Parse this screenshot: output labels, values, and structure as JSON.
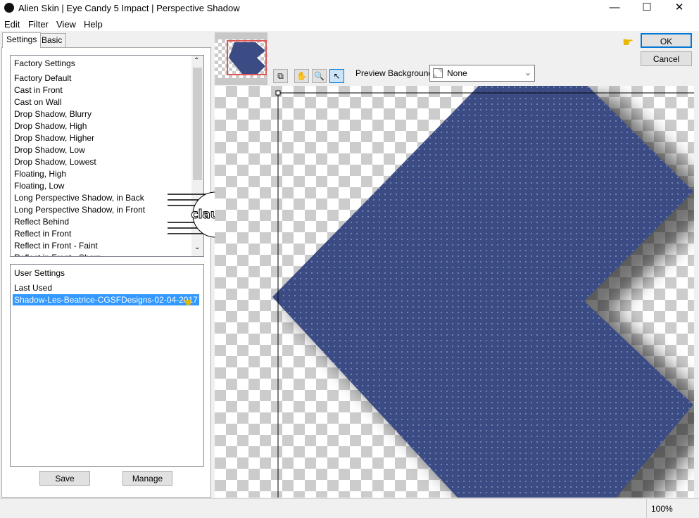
{
  "window": {
    "title": "Alien Skin | Eye Candy 5 Impact | Perspective Shadow",
    "minimize": "—",
    "maximize": "☐",
    "close": "✕"
  },
  "menu": [
    "Edit",
    "Filter",
    "View",
    "Help"
  ],
  "tabs": [
    "Settings",
    "Basic"
  ],
  "factory": {
    "header": "Factory Settings",
    "items": [
      "Factory Default",
      "Cast in Front",
      "Cast on Wall",
      "Drop Shadow, Blurry",
      "Drop Shadow, High",
      "Drop Shadow, Higher",
      "Drop Shadow, Low",
      "Drop Shadow, Lowest",
      "Floating, High",
      "Floating, Low",
      "Long Perspective Shadow, in Back",
      "Long Perspective Shadow, in Front",
      "Reflect Behind",
      "Reflect in Front",
      "Reflect in Front - Faint",
      "Reflect in Front - Sharp"
    ]
  },
  "user": {
    "header": "User Settings",
    "items": [
      "Last Used",
      "Shadow-Les-Beatrice-CGSFDesigns-02-04-2017"
    ],
    "selected": 1
  },
  "buttons": {
    "save": "Save",
    "manage": "Manage",
    "ok": "OK",
    "cancel": "Cancel"
  },
  "preview": {
    "bg_label": "Preview Background:",
    "bg_value": "None",
    "zoom": "100%",
    "shape_color": "#3b4c84"
  },
  "watermark": "claudia"
}
